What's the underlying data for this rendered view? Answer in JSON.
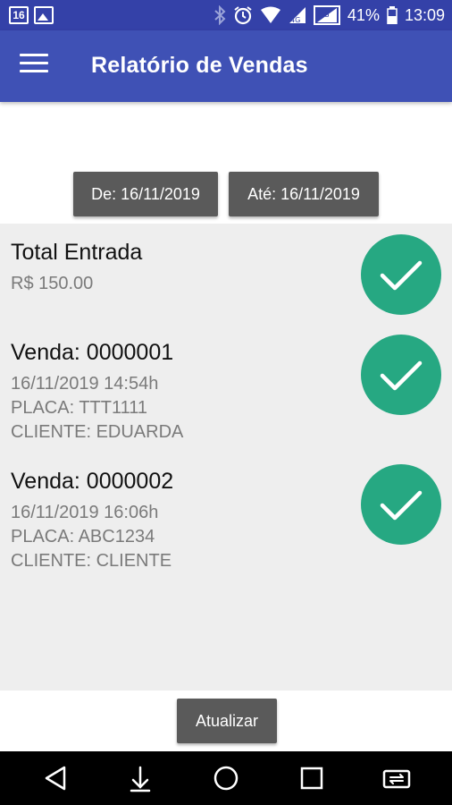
{
  "status_bar": {
    "calendar_day": "16",
    "battery_percent": "41%",
    "time": "13:09",
    "icons": [
      "calendar-icon",
      "image-icon",
      "bluetooth-icon",
      "alarm-icon",
      "wifi-icon",
      "signal-icon",
      "signal-icon",
      "battery-icon"
    ]
  },
  "app_bar": {
    "title": "Relatório de Vendas",
    "menu_icon": "menu-icon"
  },
  "filters": {
    "from_label": "De: 16/11/2019",
    "to_label": "Até: 16/11/2019"
  },
  "summary": {
    "title": "Total Entrada",
    "amount": "R$ 150.00",
    "check_icon": "check-icon"
  },
  "sales": [
    {
      "title": "Venda: 0000001",
      "datetime": "16/11/2019 14:54h",
      "plate": "PLACA: TTT1111",
      "client": "CLIENTE: EDUARDA"
    },
    {
      "title": "Venda: 0000002",
      "datetime": "16/11/2019 16:06h",
      "plate": "PLACA: ABC1234",
      "client": "CLIENTE: CLIENTE"
    }
  ],
  "actions": {
    "refresh_label": "Atualizar"
  },
  "nav_bar": {
    "icons": [
      "back-icon",
      "download-icon",
      "home-icon",
      "recents-icon",
      "switch-icon"
    ]
  },
  "colors": {
    "status_bar": "#3441a8",
    "app_bar": "#3f51b5",
    "check": "#26a882",
    "button": "#5a5a5a",
    "list_bg": "#eeeeee"
  }
}
